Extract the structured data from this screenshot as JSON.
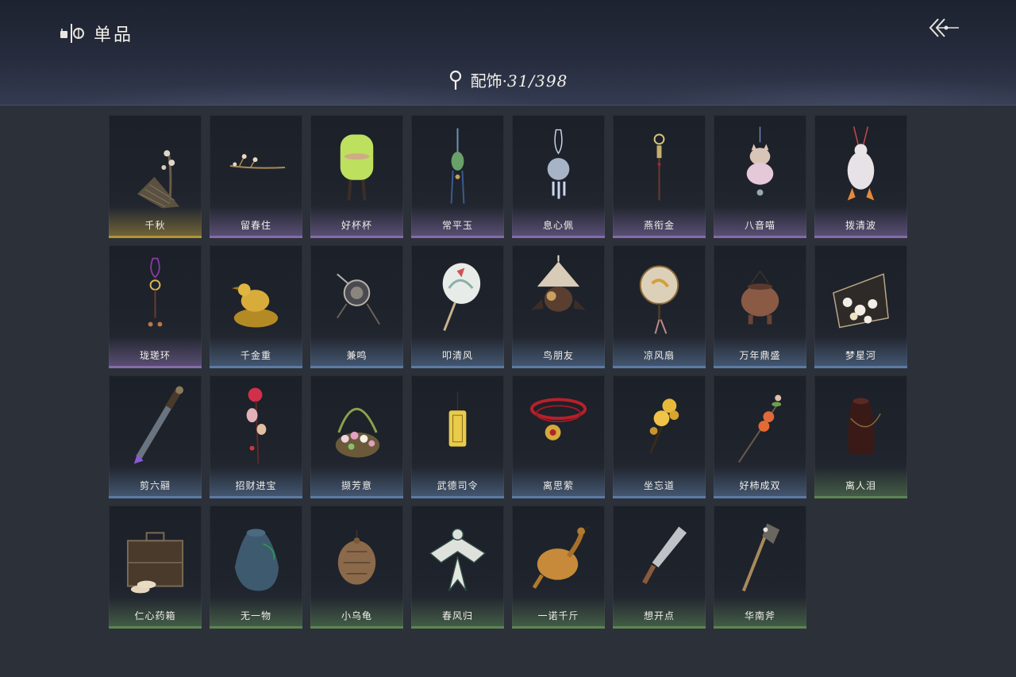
{
  "header": {
    "title": "单品",
    "icon": "collection-icon",
    "back_icon": "back-arrow-icon",
    "category_label": "配饰·",
    "category_count": "31/398"
  },
  "colors": {
    "rarity_gold": "#b89a3a",
    "rarity_purple": "#8a6fae",
    "rarity_blue": "#5f7fa8",
    "rarity_green": "#5f8a55"
  },
  "items": [
    {
      "name": "千秋",
      "rarity": "gold",
      "art": "qin"
    },
    {
      "name": "留春住",
      "rarity": "purple",
      "art": "branch"
    },
    {
      "name": "好杯杯",
      "rarity": "purple",
      "art": "cup"
    },
    {
      "name": "常平玉",
      "rarity": "purple",
      "art": "tassel"
    },
    {
      "name": "息心佩",
      "rarity": "purple",
      "art": "pendant"
    },
    {
      "name": "燕衔金",
      "rarity": "purple",
      "art": "hairpin"
    },
    {
      "name": "八音喵",
      "rarity": "purple",
      "art": "cat"
    },
    {
      "name": "拨清波",
      "rarity": "purple",
      "art": "duck"
    },
    {
      "name": "珑瑳环",
      "rarity": "purple",
      "art": "ring"
    },
    {
      "name": "千金重",
      "rarity": "blue",
      "art": "bird-statue"
    },
    {
      "name": "兼鸣",
      "rarity": "blue",
      "art": "disc"
    },
    {
      "name": "叩清风",
      "rarity": "blue",
      "art": "fan"
    },
    {
      "name": "鸟朋友",
      "rarity": "blue",
      "art": "bird"
    },
    {
      "name": "凉风扇",
      "rarity": "blue",
      "art": "round-fan"
    },
    {
      "name": "万年鼎盛",
      "rarity": "blue",
      "art": "cauldron"
    },
    {
      "name": "梦星河",
      "rarity": "blue",
      "art": "flower-tray"
    },
    {
      "name": "剪六翮",
      "rarity": "blue",
      "art": "sword"
    },
    {
      "name": "招财进宝",
      "rarity": "blue",
      "art": "red-pin"
    },
    {
      "name": "撷芳意",
      "rarity": "blue",
      "art": "basket"
    },
    {
      "name": "武德司令",
      "rarity": "blue",
      "art": "token"
    },
    {
      "name": "离思萦",
      "rarity": "blue",
      "art": "necklace"
    },
    {
      "name": "坐忘道",
      "rarity": "blue",
      "art": "gold-flower"
    },
    {
      "name": "好柿成双",
      "rarity": "blue",
      "art": "persimmon"
    },
    {
      "name": "离人泪",
      "rarity": "green",
      "art": "jar"
    },
    {
      "name": "仁心药箱",
      "rarity": "green",
      "art": "box"
    },
    {
      "name": "无一物",
      "rarity": "green",
      "art": "pouch"
    },
    {
      "name": "小乌龟",
      "rarity": "green",
      "art": "turtle"
    },
    {
      "name": "春风归",
      "rarity": "green",
      "art": "kite"
    },
    {
      "name": "一诺千斤",
      "rarity": "green",
      "art": "roast-chicken"
    },
    {
      "name": "想开点",
      "rarity": "green",
      "art": "knife"
    },
    {
      "name": "华南斧",
      "rarity": "green",
      "art": "axe"
    }
  ]
}
